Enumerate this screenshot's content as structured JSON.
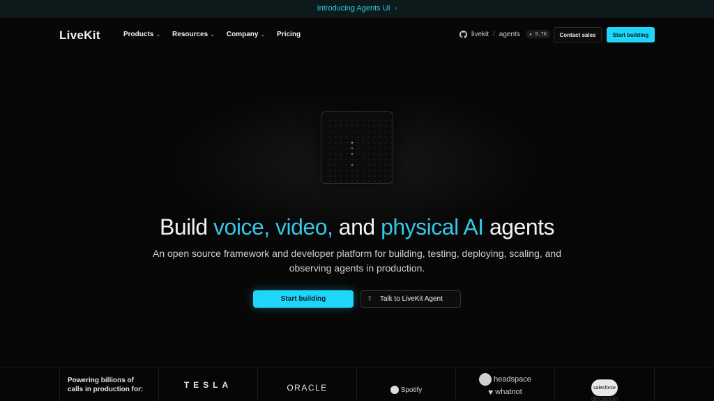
{
  "announcement": {
    "text": "Introducing Agents UI",
    "chevron": "›"
  },
  "nav": {
    "logo": "LiveKit",
    "menu": [
      {
        "label": "Products",
        "has_dropdown": true
      },
      {
        "label": "Resources",
        "has_dropdown": true
      },
      {
        "label": "Company",
        "has_dropdown": true
      },
      {
        "label": "Pricing",
        "has_dropdown": false
      }
    ],
    "caret": "⌄",
    "github": {
      "icon": "github-icon",
      "org": "livekit",
      "separator": "/",
      "repo": "agents",
      "stars": "★ 9.7K"
    },
    "contact_label": "Contact sales",
    "start_label": "Start building"
  },
  "hero": {
    "headline": {
      "part1": "Build ",
      "accent1": "voice, video,",
      "part2": " and ",
      "accent2": "physical AI",
      "part3": " agents"
    },
    "subtitle": "An open source framework and developer platform for building, testing, deploying, scaling, and observing agents in production.",
    "cta_primary": "Start building",
    "cta_secondary": "Talk to LiveKit Agent",
    "cta_secondary_icon": "T"
  },
  "logos": {
    "powering_text": "Powering billions of calls in production for:",
    "tesla": "TESLA",
    "oracle": "ORACLE",
    "spotify": "Spotify",
    "headspace": "headspace",
    "whatnot": "whatnot",
    "salesforce": "salesforce",
    "decagon": "decagon"
  },
  "colors": {
    "accent": "#35c7e6",
    "button": "#1fd5f9",
    "background": "#070707"
  }
}
